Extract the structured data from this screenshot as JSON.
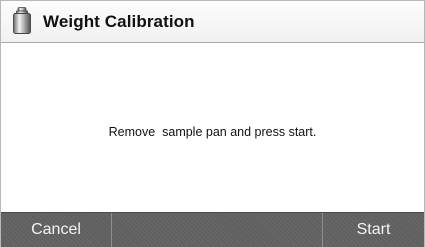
{
  "window": {
    "title": "Weight Calibration",
    "icon": "calibration-weight-icon"
  },
  "main": {
    "message": "Remove  sample pan and press start."
  },
  "footer": {
    "cancel_label": "Cancel",
    "start_label": "Start"
  },
  "colors": {
    "header_bg": "#f5f5f5",
    "footer_bg": "#5f5f5f",
    "footer_text": "#f4f4f4"
  }
}
